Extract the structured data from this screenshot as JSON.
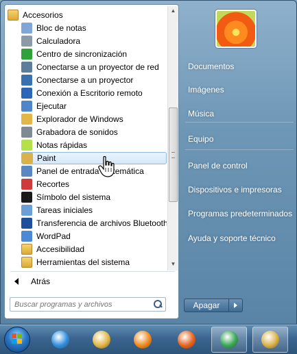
{
  "programs": {
    "folder_accesorios": "Accesorios",
    "items": [
      {
        "label": "Bloc de notas",
        "icon": "notepad-icon",
        "color": "#7fa6d6"
      },
      {
        "label": "Calculadora",
        "icon": "calculator-icon",
        "color": "#8c9aa8"
      },
      {
        "label": "Centro de sincronización",
        "icon": "sync-center-icon",
        "color": "#2fa33a"
      },
      {
        "label": "Conectarse a un proyector de red",
        "icon": "network-projector-icon",
        "color": "#5d7d9a"
      },
      {
        "label": "Conectarse a un proyector",
        "icon": "projector-icon",
        "color": "#3a6fb0"
      },
      {
        "label": "Conexión a Escritorio remoto",
        "icon": "remote-desktop-icon",
        "color": "#2b66b8"
      },
      {
        "label": "Ejecutar",
        "icon": "run-icon",
        "color": "#4e86c9"
      },
      {
        "label": "Explorador de Windows",
        "icon": "explorer-icon",
        "color": "#e3b746"
      },
      {
        "label": "Grabadora de sonidos",
        "icon": "microphone-icon",
        "color": "#7e8a94"
      },
      {
        "label": "Notas rápidas",
        "icon": "sticky-notes-icon",
        "color": "#b6e04a"
      },
      {
        "label": "Paint",
        "icon": "paint-icon",
        "color": "#d9b24a"
      },
      {
        "label": "Panel de entrada matemática",
        "icon": "math-input-icon",
        "color": "#5a88c2"
      },
      {
        "label": "Recortes",
        "icon": "snipping-tool-icon",
        "color": "#d13a3a"
      },
      {
        "label": "Símbolo del sistema",
        "icon": "command-prompt-icon",
        "color": "#1a1a1a"
      },
      {
        "label": "Tareas iniciales",
        "icon": "getting-started-icon",
        "color": "#6a9fd8"
      },
      {
        "label": "Transferencia de archivos Bluetooth",
        "icon": "bluetooth-icon",
        "color": "#1f4e9c"
      },
      {
        "label": "WordPad",
        "icon": "wordpad-icon",
        "color": "#4c8ad8"
      },
      {
        "label": "Accesibilidad",
        "icon": "folder-icon",
        "color": "#e7bd52"
      },
      {
        "label": "Herramientas del sistema",
        "icon": "folder-icon",
        "color": "#e7bd52"
      }
    ],
    "highlighted": "Paint",
    "back_label": "Atrás"
  },
  "search": {
    "placeholder": "Buscar programas y archivos"
  },
  "right_links": [
    "Documentos",
    "Imágenes",
    "Música",
    "Equipo",
    "Panel de control",
    "Dispositivos e impresoras",
    "Programas predeterminados",
    "Ayuda y soporte técnico"
  ],
  "shutdown": {
    "label": "Apagar"
  },
  "taskbar": {
    "items": [
      {
        "name": "internet-explorer-icon",
        "color": "#2f8fe0"
      },
      {
        "name": "folder-icon",
        "color": "#e3b746"
      },
      {
        "name": "media-player-icon",
        "color": "#f08a1e"
      },
      {
        "name": "firefox-icon",
        "color": "#e8641e"
      },
      {
        "name": "chrome-icon",
        "color": "#3aa757"
      },
      {
        "name": "paint-icon",
        "color": "#d9b24a"
      }
    ]
  }
}
